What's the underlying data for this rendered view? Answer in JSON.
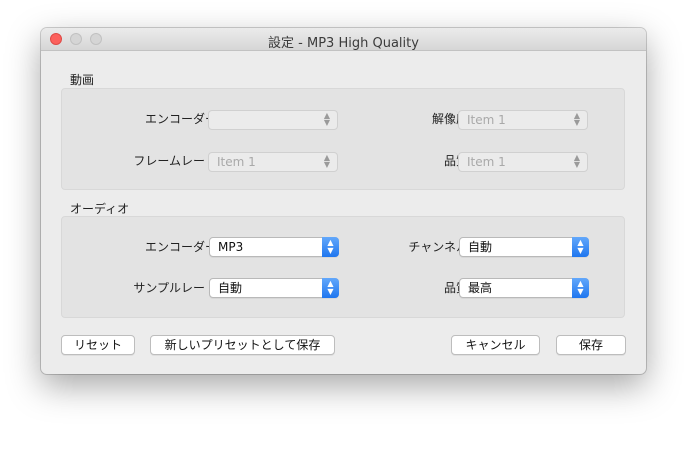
{
  "window": {
    "title": "設定 - MP3 High Quality"
  },
  "video": {
    "label": "動画",
    "encoder_label": "エンコーダー",
    "encoder_value": "",
    "resolution_label": "解像度",
    "resolution_value": "Item 1",
    "framerate_label": "フレームレート",
    "framerate_value": "Item 1",
    "quality_label": "品質",
    "quality_value": "Item 1"
  },
  "audio": {
    "label": "オーディオ",
    "encoder_label": "エンコーダー",
    "encoder_value": "MP3",
    "channel_label": "チャンネル",
    "channel_value": "自動",
    "samplerate_label": "サンプルレート",
    "samplerate_value": "自動",
    "quality_label": "品質",
    "quality_value": "最高"
  },
  "buttons": {
    "reset": "リセット",
    "save_as_preset": "新しいプリセットとして保存",
    "cancel": "キャンセル",
    "save": "保存"
  },
  "colors": {
    "close": "#fc605c",
    "accent": "#1f76ef"
  }
}
